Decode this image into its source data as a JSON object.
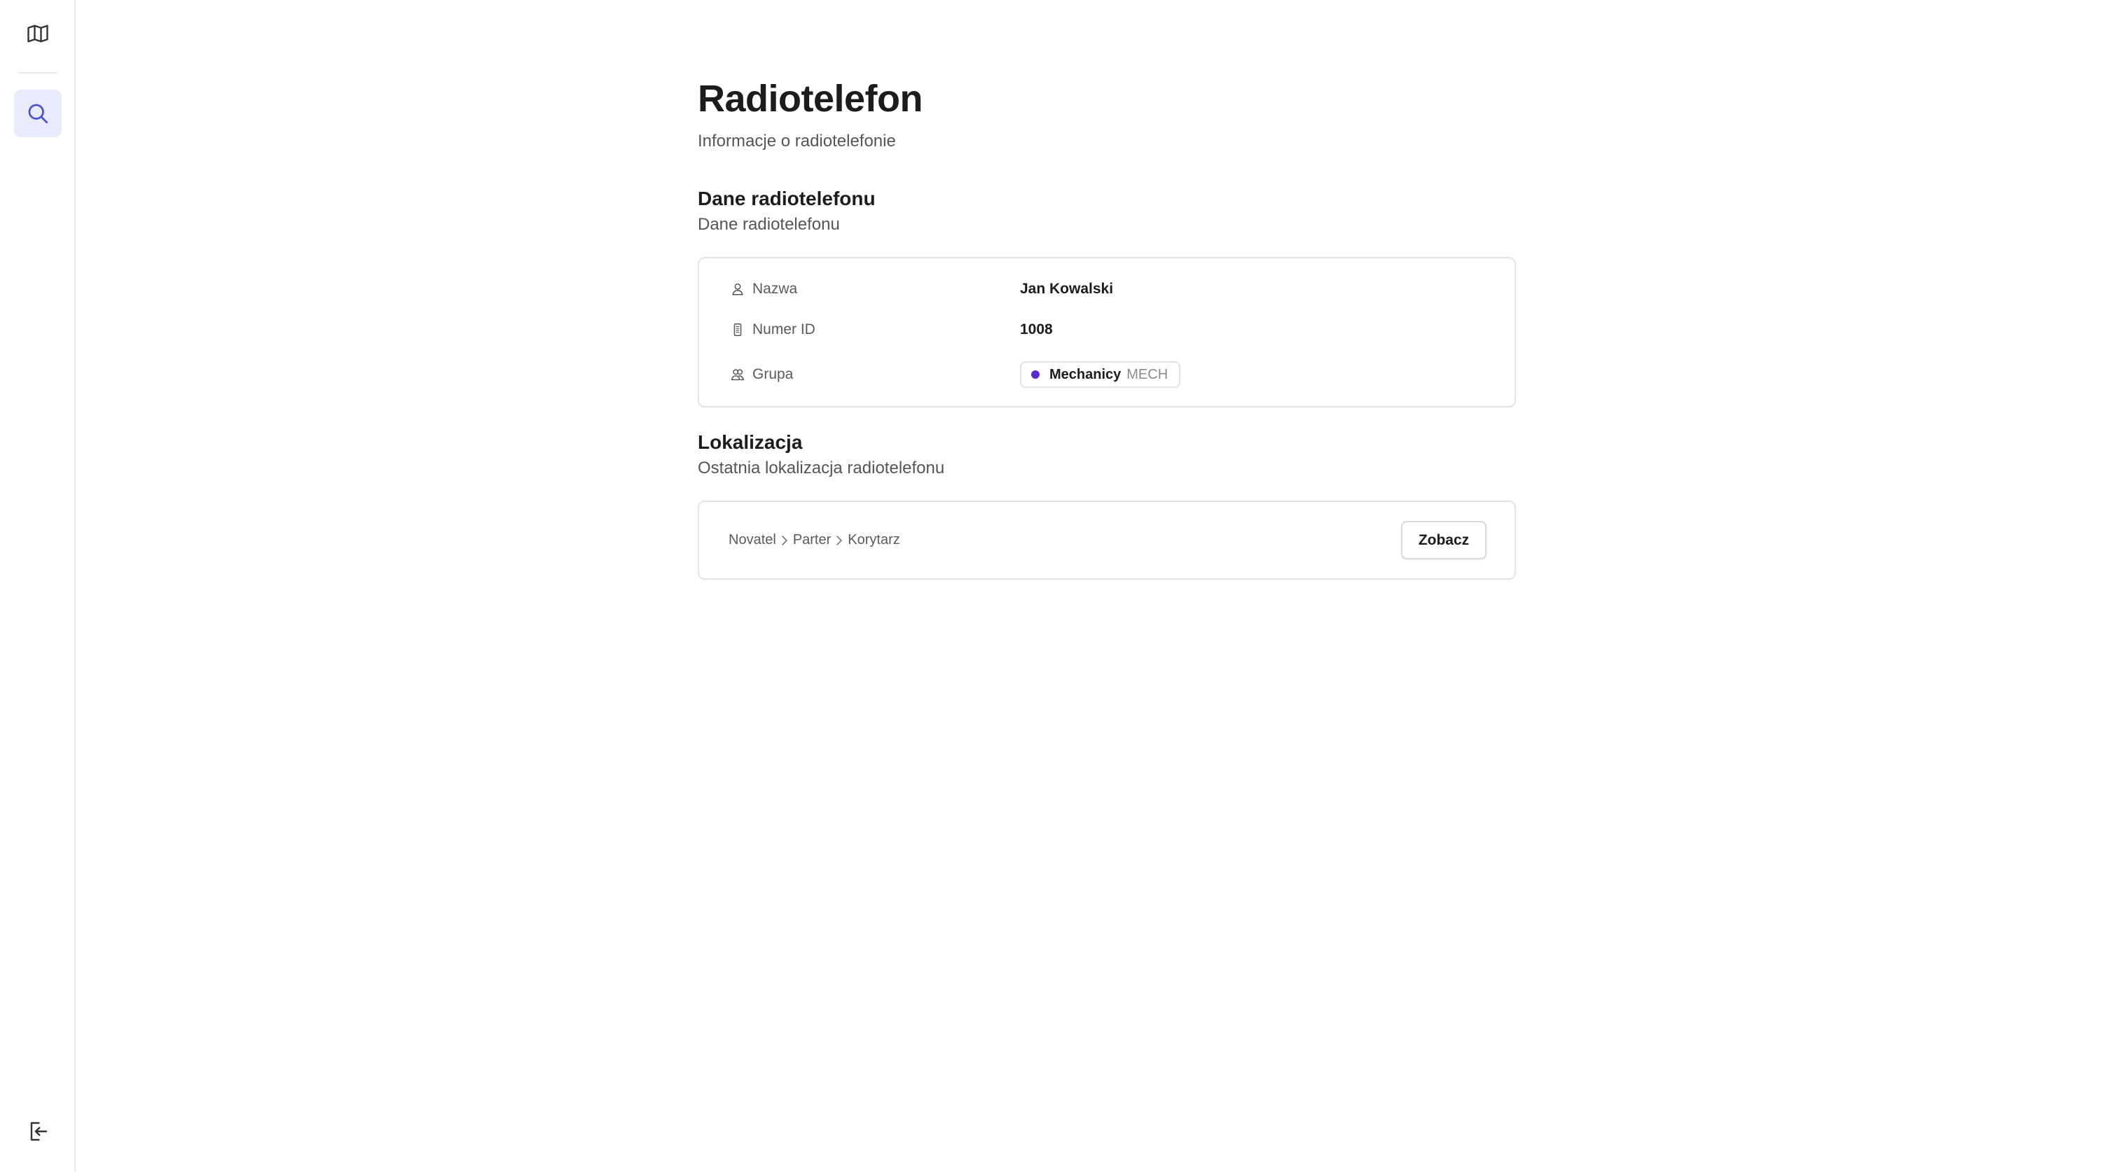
{
  "sidebar": {
    "items": [
      {
        "icon": "map-icon",
        "active": false
      },
      {
        "icon": "search-icon",
        "active": true
      },
      {
        "icon": "logout-icon",
        "active": false
      }
    ]
  },
  "page": {
    "title": "Radiotelefon",
    "subtitle": "Informacje o radiotelefonie"
  },
  "details": {
    "title": "Dane radiotelefonu",
    "subtitle": "Dane radiotelefonu",
    "rows": [
      {
        "label": "Nazwa",
        "icon": "user-icon",
        "value": "Jan Kowalski"
      },
      {
        "label": "Numer ID",
        "icon": "device-icon",
        "value": "1008"
      },
      {
        "label": "Grupa",
        "icon": "users-icon"
      }
    ],
    "group": {
      "name": "Mechanicy",
      "code": "MECH",
      "color": "#5b2bd1"
    }
  },
  "location": {
    "title": "Lokalizacja",
    "subtitle": "Ostatnia lokalizacja radiotelefonu",
    "path": [
      "Novatel",
      "Parter",
      "Korytarz"
    ],
    "button_label": "Zobacz"
  },
  "colors": {
    "accent": "#4651d8",
    "active_bg": "#e8ebfb"
  }
}
